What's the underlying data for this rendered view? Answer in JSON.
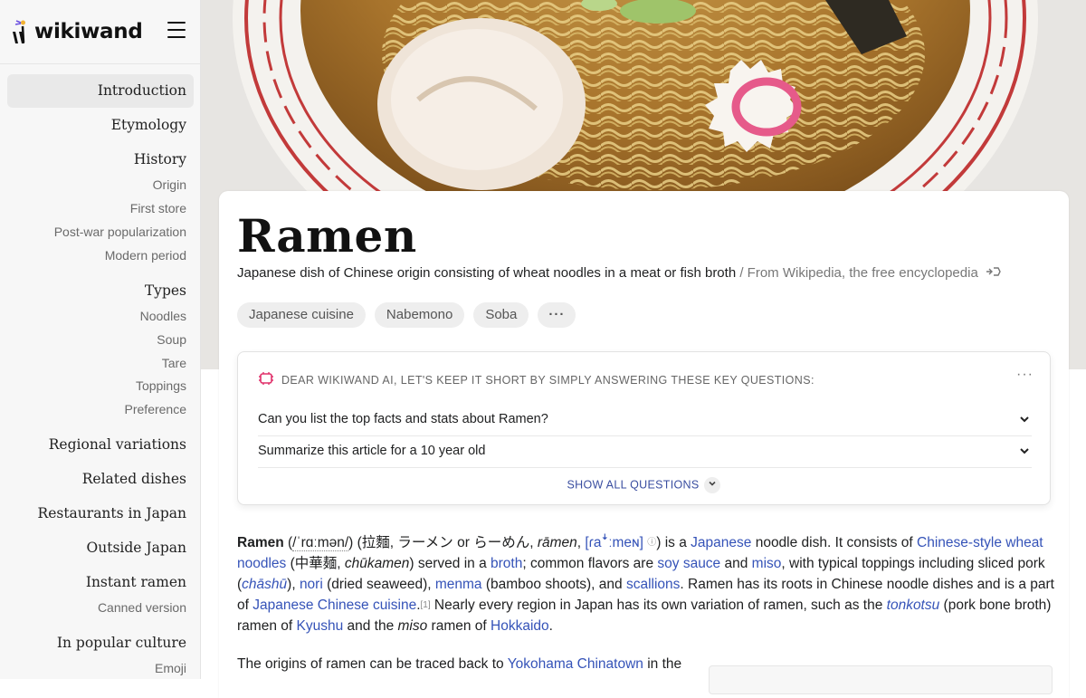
{
  "brand": {
    "name": "wikiwand"
  },
  "toc": [
    {
      "label": "Introduction",
      "level": "main",
      "active": true
    },
    {
      "label": "Etymology",
      "level": "main"
    },
    {
      "label": "History",
      "level": "main"
    },
    {
      "label": "Origin",
      "level": "sub"
    },
    {
      "label": "First store",
      "level": "sub"
    },
    {
      "label": "Post-war popularization",
      "level": "sub"
    },
    {
      "label": "Modern period",
      "level": "sub"
    },
    {
      "label": "Types",
      "level": "main"
    },
    {
      "label": "Noodles",
      "level": "sub"
    },
    {
      "label": "Soup",
      "level": "sub"
    },
    {
      "label": "Tare",
      "level": "sub"
    },
    {
      "label": "Toppings",
      "level": "sub"
    },
    {
      "label": "Preference",
      "level": "sub"
    },
    {
      "label": "Regional variations",
      "level": "main"
    },
    {
      "label": "Related dishes",
      "level": "main"
    },
    {
      "label": "Restaurants in Japan",
      "level": "main"
    },
    {
      "label": "Outside Japan",
      "level": "main"
    },
    {
      "label": "Instant ramen",
      "level": "main"
    },
    {
      "label": "Canned version",
      "level": "sub"
    },
    {
      "label": "In popular culture",
      "level": "main"
    },
    {
      "label": "Emoji",
      "level": "sub"
    }
  ],
  "article": {
    "title": "Ramen",
    "description": "Japanese dish of Chinese origin consisting of wheat noodles in a meat or fish broth",
    "source": "/ From Wikipedia, the free encyclopedia",
    "chips": [
      "Japanese cuisine",
      "Nabemono",
      "Soba",
      "···"
    ]
  },
  "ai": {
    "header": "DEAR WIKIWAND AI, LET'S KEEP IT SHORT BY SIMPLY ANSWERING THESE KEY QUESTIONS:",
    "menu": "···",
    "questions": [
      "Can you list the top facts and stats about Ramen?",
      "Summarize this article for a 10 year old"
    ],
    "show_all": "SHOW ALL QUESTIONS"
  },
  "intro": {
    "ramen": "Ramen",
    "pron_open": " (",
    "ipa": "/ˈrɑːmən/",
    "pron_rest": ") (拉麵, ラーメン or らーめん, ",
    "romaji": "rāmen",
    "comma": ", ",
    "ipa2": "[ɾaꜜːmeɴ]",
    "ipa2_mark": "ⓘ",
    "is_a": ") is a ",
    "japanese": "Japanese",
    "t1": " noodle dish. It consists of ",
    "chinese_noodles": "Chinese-style wheat noodles",
    "t2": " (中華麺, ",
    "chukamen": "chūkamen",
    "t3": ") served in a ",
    "broth": "broth",
    "t4": "; common flavors are ",
    "soy_sauce": "soy sauce",
    "t5": " and ",
    "miso": "miso",
    "t6": ", with typical toppings including sliced pork (",
    "chashu": "chāshū",
    "t7": "), ",
    "nori": "nori",
    "t8": " (dried seaweed), ",
    "menma": "menma",
    "t9": " (bamboo shoots), and ",
    "scallions": "scallions",
    "t10": ". Ramen has its roots in Chinese noodle dishes and is a part of ",
    "jcc": "Japanese Chinese cuisine",
    "t11": ".",
    "ref1": "[1]",
    "t12": " Nearly every region in Japan has its own variation of ramen, such as the ",
    "tonkotsu": "tonkotsu",
    "t13": " (pork bone broth) ramen of ",
    "kyushu": "Kyushu",
    "t14": " and the ",
    "miso2": "miso",
    "t15": " ramen of ",
    "hokkaido": "Hokkaido",
    "t16": "."
  },
  "p2": {
    "t1": "The origins of ramen can be traced back to ",
    "yokohama": "Yokohama Chinatown",
    "t2": " in the"
  },
  "colors": {
    "link": "#3553b8",
    "accent": "#e0306a"
  }
}
